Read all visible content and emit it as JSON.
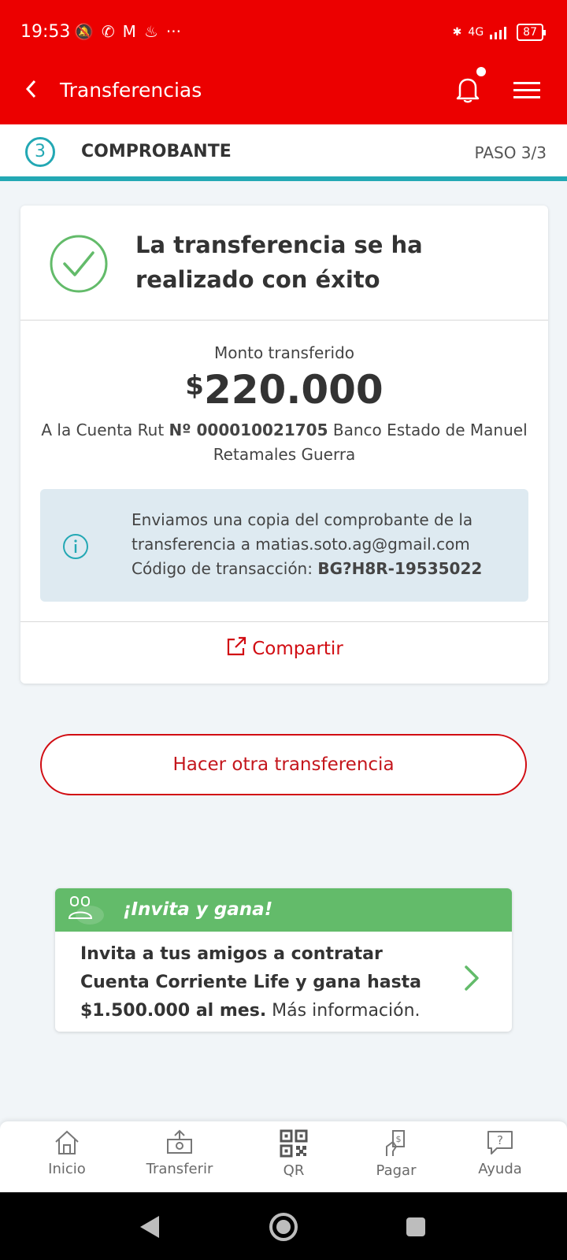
{
  "status_bar": {
    "time": "19:53",
    "network": "4G",
    "battery": "87"
  },
  "app_bar": {
    "title": "Transferencias"
  },
  "step": {
    "number": "3",
    "label": "COMPROBANTE",
    "progress": "PASO 3/3"
  },
  "receipt": {
    "success_message": "La transferencia se ha realizado con éxito",
    "amount_label": "Monto transferido",
    "currency_symbol": "$",
    "amount": "220.000",
    "dest_prefix": "A la Cuenta Rut ",
    "dest_account": "Nº 000010021705",
    "dest_suffix": " Banco Estado de Manuel Retamales Guerra",
    "info_line1": "Enviamos una copia del comprobante de la",
    "info_line2": "transferencia a matias.soto.ag@gmail.com",
    "info_code_label": "Código de transacción: ",
    "info_code": "BG?H8R-19535022",
    "share_label": "Compartir"
  },
  "actions": {
    "another_transfer": "Hacer otra transferencia"
  },
  "promo": {
    "title": "¡Invita y gana!",
    "body_bold": "Invita a tus amigos a contratar Cuenta Corriente Life y gana hasta $1.500.000 al mes.",
    "body_link": " Más información."
  },
  "bottom_nav": {
    "items": [
      {
        "label": "Inicio",
        "icon": "home-icon"
      },
      {
        "label": "Transferir",
        "icon": "transfer-icon"
      },
      {
        "label": "QR",
        "icon": "qr-icon"
      },
      {
        "label": "Pagar",
        "icon": "pay-icon"
      },
      {
        "label": "Ayuda",
        "icon": "help-icon"
      }
    ]
  },
  "colors": {
    "brand_red": "#ec0000",
    "teal": "#23a8b4",
    "success_green": "#63bb6a",
    "info_bg": "#deeaf1"
  }
}
